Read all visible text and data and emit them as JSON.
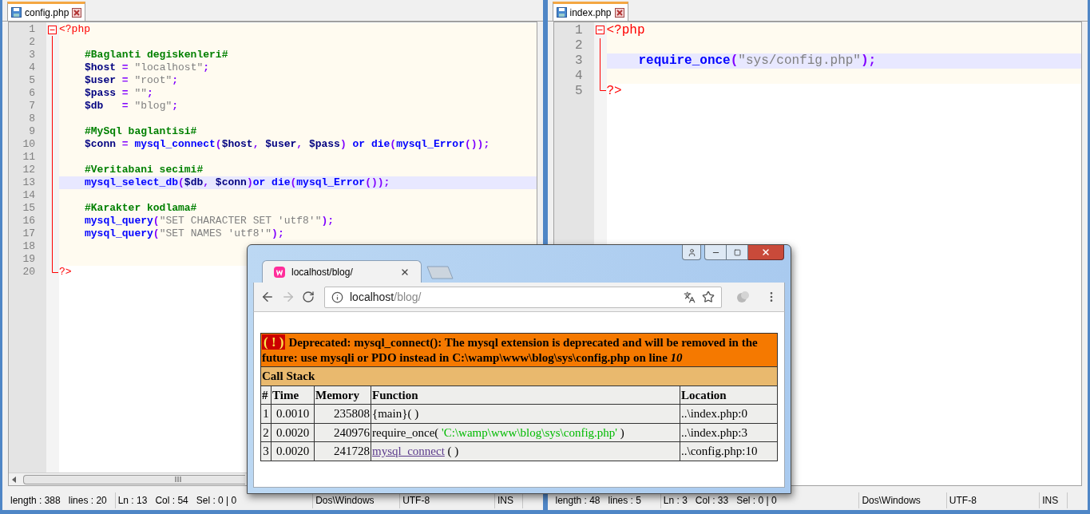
{
  "editors": [
    {
      "tab": {
        "label": "config.php",
        "selected": true
      },
      "lines": [
        {
          "no": "1",
          "kind": "fold-start",
          "current": false,
          "tokens": [
            {
              "kind": "tag",
              "text": "<?php"
            }
          ]
        },
        {
          "no": "2",
          "kind": "fold-inside",
          "current": false
        },
        {
          "no": "3",
          "kind": "fold-inside",
          "current": false,
          "indent": true,
          "tokens": [
            {
              "kind": "comment",
              "text": "#Baglanti degiskenleri#"
            }
          ]
        },
        {
          "no": "4",
          "kind": "fold-inside",
          "current": false,
          "indent": true,
          "tokens": [
            {
              "kind": "var",
              "text": "$host"
            },
            {
              "kind": "op",
              "text": " = "
            },
            {
              "kind": "str",
              "text": "\"localhost\""
            },
            {
              "kind": "op",
              "text": ";"
            }
          ]
        },
        {
          "no": "5",
          "kind": "fold-inside",
          "current": false,
          "indent": true,
          "tokens": [
            {
              "kind": "var",
              "text": "$user"
            },
            {
              "kind": "op",
              "text": " = "
            },
            {
              "kind": "str",
              "text": "\"root\""
            },
            {
              "kind": "op",
              "text": ";"
            }
          ]
        },
        {
          "no": "6",
          "kind": "fold-inside",
          "current": false,
          "indent": true,
          "tokens": [
            {
              "kind": "var",
              "text": "$pass"
            },
            {
              "kind": "op",
              "text": " = "
            },
            {
              "kind": "str",
              "text": "\"\""
            },
            {
              "kind": "op",
              "text": ";"
            }
          ]
        },
        {
          "no": "7",
          "kind": "fold-inside",
          "current": false,
          "indent": true,
          "tokens": [
            {
              "kind": "var",
              "text": "$db"
            },
            {
              "kind": "op",
              "text": "   = "
            },
            {
              "kind": "str",
              "text": "\"blog\""
            },
            {
              "kind": "op",
              "text": ";"
            }
          ]
        },
        {
          "no": "8",
          "kind": "fold-inside",
          "current": false
        },
        {
          "no": "9",
          "kind": "fold-inside",
          "current": false,
          "indent": true,
          "tokens": [
            {
              "kind": "comment",
              "text": "#MySql baglantisi#"
            }
          ]
        },
        {
          "no": "10",
          "kind": "fold-inside",
          "current": false,
          "indent": true,
          "tokens": [
            {
              "kind": "var",
              "text": "$conn"
            },
            {
              "kind": "op",
              "text": " = "
            },
            {
              "kind": "fn",
              "text": "mysql_connect"
            },
            {
              "kind": "op",
              "text": "("
            },
            {
              "kind": "var",
              "text": "$host"
            },
            {
              "kind": "op",
              "text": ", "
            },
            {
              "kind": "var",
              "text": "$user"
            },
            {
              "kind": "op",
              "text": ", "
            },
            {
              "kind": "var",
              "text": "$pass"
            },
            {
              "kind": "op",
              "text": ") "
            },
            {
              "kind": "fn",
              "text": "or die"
            },
            {
              "kind": "op",
              "text": "("
            },
            {
              "kind": "fn",
              "text": "mysql_Error"
            },
            {
              "kind": "op",
              "text": "());"
            }
          ]
        },
        {
          "no": "11",
          "kind": "fold-inside",
          "current": false
        },
        {
          "no": "12",
          "kind": "fold-inside",
          "current": false,
          "indent": true,
          "tokens": [
            {
              "kind": "comment",
              "text": "#Veritabani secimi#"
            }
          ]
        },
        {
          "no": "13",
          "kind": "fold-inside",
          "current": true,
          "indent": true,
          "tokens": [
            {
              "kind": "fn",
              "text": "mysql_select_db"
            },
            {
              "kind": "op",
              "text": "("
            },
            {
              "kind": "var",
              "text": "$db"
            },
            {
              "kind": "op",
              "text": ", "
            },
            {
              "kind": "var",
              "text": "$conn"
            },
            {
              "kind": "op",
              "text": ")"
            },
            {
              "kind": "fn",
              "text": "or die"
            },
            {
              "kind": "op",
              "text": "("
            },
            {
              "kind": "fn",
              "text": "mysql_Error"
            },
            {
              "kind": "op",
              "text": "());"
            }
          ]
        },
        {
          "no": "14",
          "kind": "fold-inside",
          "current": false
        },
        {
          "no": "15",
          "kind": "fold-inside",
          "current": false,
          "indent": true,
          "tokens": [
            {
              "kind": "comment",
              "text": "#Karakter kodlama#"
            }
          ]
        },
        {
          "no": "16",
          "kind": "fold-inside",
          "current": false,
          "indent": true,
          "tokens": [
            {
              "kind": "fn",
              "text": "mysql_query"
            },
            {
              "kind": "op",
              "text": "("
            },
            {
              "kind": "str",
              "text": "\"SET CHARACTER SET 'utf8'\""
            },
            {
              "kind": "op",
              "text": ");"
            }
          ]
        },
        {
          "no": "17",
          "kind": "fold-inside",
          "current": false,
          "indent": true,
          "tokens": [
            {
              "kind": "fn",
              "text": "mysql_query"
            },
            {
              "kind": "op",
              "text": "("
            },
            {
              "kind": "str",
              "text": "\"SET NAMES 'utf8'\""
            },
            {
              "kind": "op",
              "text": ");"
            }
          ]
        },
        {
          "no": "18",
          "kind": "fold-inside",
          "current": false
        },
        {
          "no": "19",
          "kind": "fold-inside",
          "current": false
        },
        {
          "no": "20",
          "kind": "fold-end",
          "current": false,
          "tokens": [
            {
              "kind": "tag",
              "text": "?>"
            }
          ]
        }
      ],
      "status": [
        [
          "length : 388",
          "lines : 20"
        ],
        [
          "Ln : 13",
          "Col : 54",
          "Sel : 0 | 0"
        ],
        [
          "Dos\\Windows"
        ],
        [
          "UTF-8"
        ],
        [
          "INS"
        ]
      ]
    },
    {
      "tab": {
        "label": "index.php",
        "selected": true
      },
      "lines": [
        {
          "no": "1",
          "kind": "fold-start",
          "current": false,
          "tokens": [
            {
              "kind": "tag",
              "text": "<?php"
            }
          ]
        },
        {
          "no": "2",
          "kind": "fold-inside",
          "current": false
        },
        {
          "no": "3",
          "kind": "fold-inside",
          "current": true,
          "indent": true,
          "tokens": [
            {
              "kind": "fn",
              "text": "require_once"
            },
            {
              "kind": "op",
              "text": "("
            },
            {
              "kind": "str",
              "text": "\"sys/config.php\""
            },
            {
              "kind": "op",
              "text": ");"
            }
          ]
        },
        {
          "no": "4",
          "kind": "fold-inside",
          "current": false
        },
        {
          "no": "5",
          "kind": "fold-end",
          "current": false,
          "tokens": [
            {
              "kind": "tag",
              "text": "?>"
            }
          ]
        }
      ],
      "status": [
        [
          "length : 48",
          "lines : 5"
        ],
        [
          "Ln : 3",
          "Col : 33",
          "Sel : 0 | 0"
        ],
        [
          "Dos\\Windows"
        ],
        [
          "UTF-8"
        ],
        [
          "INS"
        ]
      ]
    }
  ],
  "browser": {
    "tab": {
      "title": "localhost/blog/",
      "selected": true
    },
    "address": {
      "host": "localhost",
      "path": "/blog/"
    },
    "error": {
      "badge": "( ! )",
      "message": "Deprecated: mysql_connect(): The mysql extension is deprecated and will be removed in the future: use mysqli or PDO instead in C:\\wamp\\www\\blog\\sys\\config.php on line *10*",
      "section": "Call Stack",
      "columns": [
        "#",
        "Time",
        "Memory",
        "Function",
        "Location"
      ],
      "rows": [
        {
          "index": "1",
          "time": "0.0010",
          "memory": "235808",
          "function": [
            {
              "kind": "plain",
              "text": "{main}( )"
            }
          ],
          "location": "..\\index.php:0"
        },
        {
          "index": "2",
          "time": "0.0020",
          "memory": "240976",
          "function": [
            {
              "kind": "plain",
              "text": "require_once( "
            },
            {
              "kind": "string",
              "text": "'C:\\wamp\\www\\blog\\sys\\config.php'"
            },
            {
              "kind": "plain",
              "text": " )"
            }
          ],
          "location": "..\\index.php:3"
        },
        {
          "index": "3",
          "time": "0.0020",
          "memory": "241728",
          "function": [
            {
              "kind": "link",
              "text": "mysql_connect"
            },
            {
              "kind": "plain",
              "text": " ( )"
            }
          ],
          "location": "..\\config.php:10"
        }
      ]
    }
  }
}
